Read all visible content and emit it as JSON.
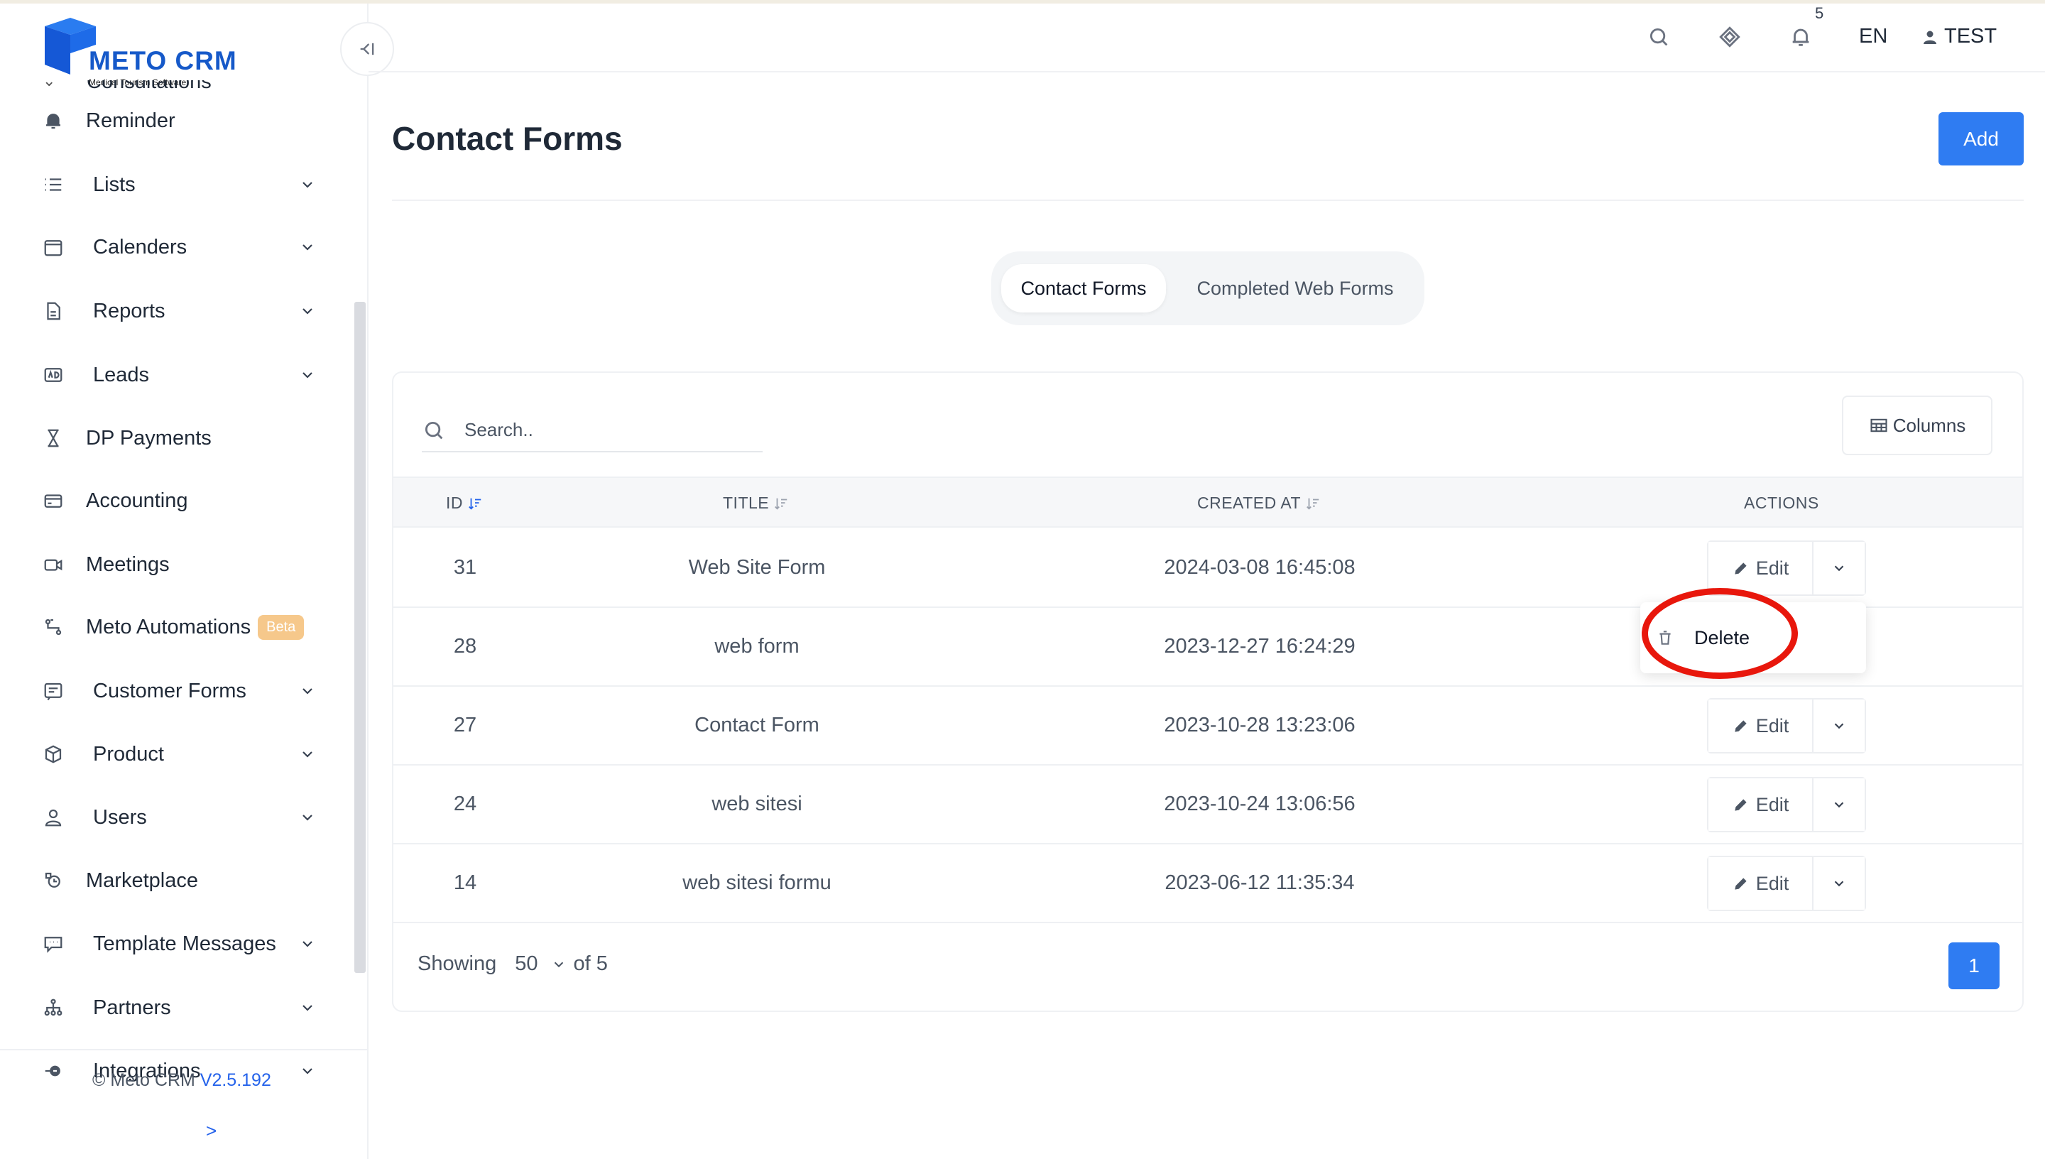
{
  "brand": {
    "name": "METO CRM",
    "tagline": "Medical Tourism Software",
    "color": "#1659c9"
  },
  "sidebar": {
    "cut_item": "Consultations",
    "items": [
      {
        "label": "Reminder",
        "icon": "bell-icon",
        "chevron": false
      },
      {
        "label": "Lists",
        "icon": "list-icon",
        "chevron": true
      },
      {
        "label": "Calenders",
        "icon": "calendar-icon",
        "chevron": true
      },
      {
        "label": "Reports",
        "icon": "document-icon",
        "chevron": true
      },
      {
        "label": "Leads",
        "icon": "ad-icon",
        "chevron": true
      },
      {
        "label": "DP Payments",
        "icon": "hourglass-icon",
        "chevron": false
      },
      {
        "label": "Accounting",
        "icon": "credit-card-icon",
        "chevron": false
      },
      {
        "label": "Meetings",
        "icon": "video-icon",
        "chevron": false
      },
      {
        "label": "Meto Automations",
        "icon": "automation-icon",
        "chevron": false,
        "badge": "Beta"
      },
      {
        "label": "Customer Forms",
        "icon": "form-icon",
        "chevron": true
      },
      {
        "label": "Product",
        "icon": "box-icon",
        "chevron": true
      },
      {
        "label": "Users",
        "icon": "user-icon",
        "chevron": true
      },
      {
        "label": "Marketplace",
        "icon": "marketplace-icon",
        "chevron": false
      },
      {
        "label": "Template Messages",
        "icon": "chat-icon",
        "chevron": true
      },
      {
        "label": "Partners",
        "icon": "partners-icon",
        "chevron": true
      },
      {
        "label": "Integrations",
        "icon": "plug-icon",
        "chevron": true
      }
    ],
    "footer": {
      "copyright": "© Meto CRM",
      "version": "V2.5.192",
      "expand": ">"
    }
  },
  "header": {
    "notification_count": "5",
    "language": "EN",
    "user": "TEST"
  },
  "main": {
    "title": "Contact Forms",
    "add_label": "Add",
    "tabs": [
      {
        "label": "Contact Forms",
        "active": true
      },
      {
        "label": "Completed Web Forms",
        "active": false
      }
    ],
    "search_placeholder": "Search..",
    "columns_label": "Columns",
    "table": {
      "headers": [
        "ID",
        "TITLE",
        "CREATED AT",
        "ACTIONS"
      ],
      "rows": [
        {
          "id": "31",
          "title": "Web Site Form",
          "created_at": "2024-03-08 16:45:08"
        },
        {
          "id": "28",
          "title": "web form",
          "created_at": "2023-12-27 16:24:29"
        },
        {
          "id": "27",
          "title": "Contact Form",
          "created_at": "2023-10-28 13:23:06"
        },
        {
          "id": "24",
          "title": "web sitesi",
          "created_at": "2023-10-24 13:06:56"
        },
        {
          "id": "14",
          "title": "web sitesi formu",
          "created_at": "2023-06-12 11:35:34"
        }
      ],
      "edit_label": "Edit",
      "dropdown_delete": "Delete"
    },
    "pagination": {
      "showing_label": "Showing",
      "page_size": "50",
      "of_label": "of 5",
      "current_page": "1"
    },
    "accent_color": "#2f7cf2",
    "highlight_color": "#e8170c"
  }
}
